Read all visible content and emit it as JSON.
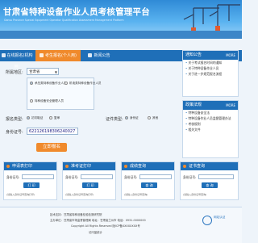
{
  "header": {
    "title": "甘肃省特种设备作业人员考核管理平台",
    "subtitle": "Gansu Province Special Equipment Operator Qualification Assessment Management Platform"
  },
  "tabs": [
    {
      "label": "在线报名(机构用)"
    },
    {
      "label": "考生报名(个人用)"
    },
    {
      "label": "新闻公告"
    }
  ],
  "form": {
    "province_label": "所属地区:",
    "province_value": "甘肃省",
    "type_options": [
      "承压类特种设备作业人员",
      "机电类特种设备作业人员",
      "特种设备安全管理人员"
    ],
    "exam_type_label": "报名类型:",
    "exam_type_options": [
      "初次取证",
      "复审"
    ],
    "cert_label": "证件类型:",
    "cert_options": [
      "身份证",
      "其他"
    ],
    "id_label": "身份证号:",
    "id_value": "622126198306240027",
    "submit_label": "立即报名"
  },
  "news_top": {
    "title": "通知公告",
    "more": "MORE",
    "items": [
      "关于考试报名时间的通知",
      "关于特种设备作业人员",
      "关于进一步规范报名流程"
    ]
  },
  "news_bottom": {
    "title": "政策法规",
    "more": "MORE",
    "items": [
      "特种设备安全法",
      "特种设备作业人员监督管理办法",
      "考核规则",
      "相关文件"
    ]
  },
  "cards": [
    {
      "title": "申请表打印",
      "label": "身份证号:",
      "button": "打 印",
      "note": "(请输入身份证号查询打印)"
    },
    {
      "title": "准考证打印",
      "label": "身份证号:",
      "button": "打 印",
      "note": "(请输入身份证号查询打印)"
    },
    {
      "title": "成绩查询",
      "label": "身份证号:",
      "button": "查 询",
      "note": "(请输入身份证号查询)"
    },
    {
      "title": "证书查询",
      "label": "身份证号:",
      "button": "查 询",
      "note": "(请输入身份证号查询)"
    }
  ],
  "footer": {
    "line1": "技术支持：甘肃省特种设备检验检测研究院",
    "line2": "主办单位：甘肃省市场监督管理局  地址：甘肃省兰州市  电话：0931-0000000",
    "line3": "Copyright All Rights Reserved  陇ICP备XXXXXXXX号",
    "line4": "访问量统计",
    "seal_text": "网站认证"
  },
  "colors": {
    "primary": "#1f6fb8",
    "accent": "#f08a2c"
  }
}
